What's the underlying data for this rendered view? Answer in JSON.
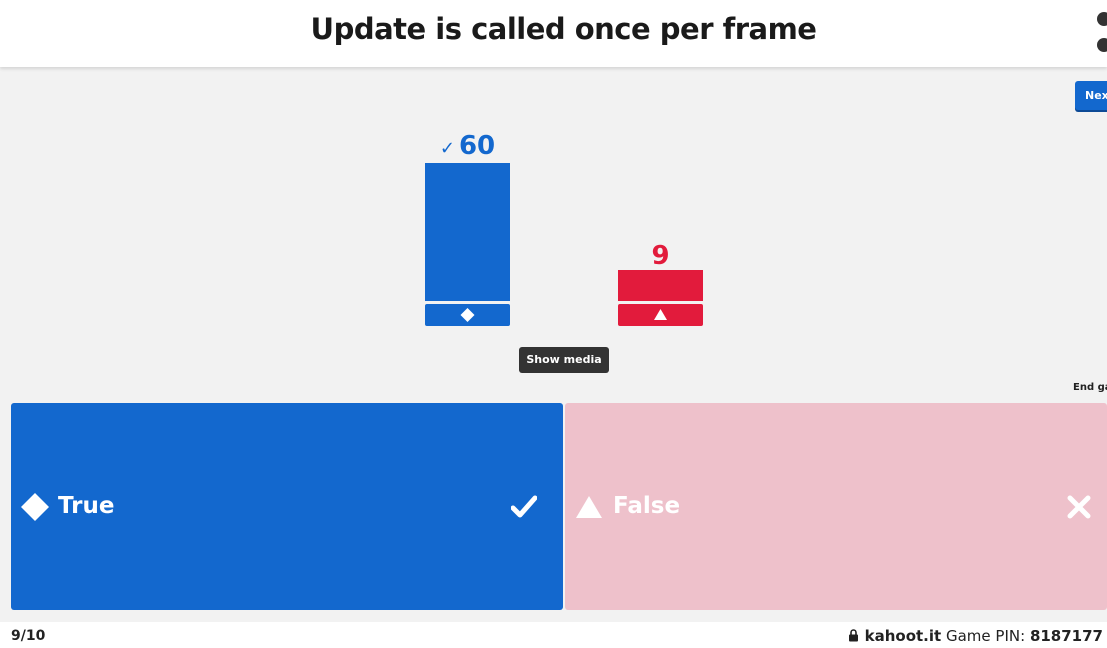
{
  "header": {
    "question": "Update is called once per frame"
  },
  "controls": {
    "next_label": "Next",
    "end_game_label": "End game",
    "show_media_label": "Show media"
  },
  "results": {
    "true_count": "60",
    "false_count": "9",
    "correct_mark": "✓"
  },
  "answers": {
    "true_label": "True",
    "false_label": "False"
  },
  "footer": {
    "progress": "9/10",
    "site": "kahoot.it",
    "pin_label": "Game PIN:",
    "pin_value": "8187177"
  },
  "colors": {
    "blue": "#1368ce",
    "red": "#e21b3c",
    "faded_red": "#eec1cb"
  }
}
